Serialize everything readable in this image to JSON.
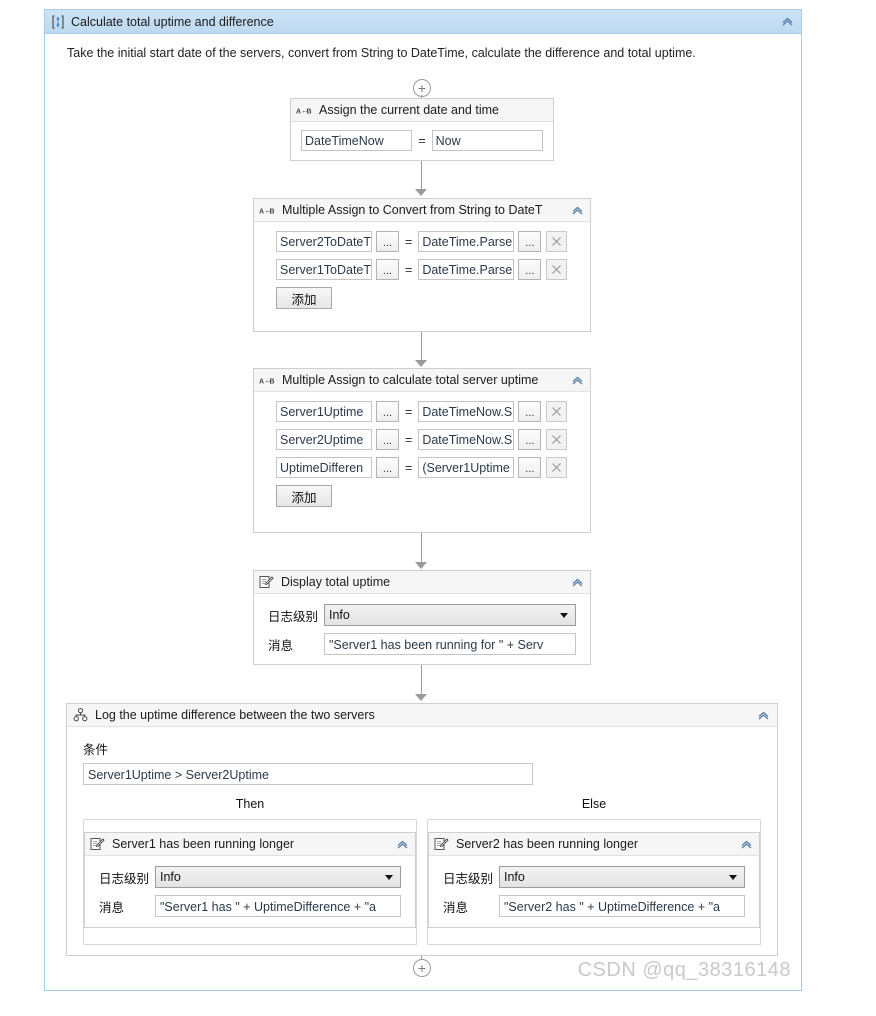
{
  "sequence": {
    "icon": "sequence-icon",
    "title": "Calculate total uptime and difference",
    "description": "Take the initial start date of the servers, convert from String to DateTime, calculate the difference and total uptime.",
    "collapse_icon": "chevron-up-icon",
    "top_plus": "+",
    "bottom_plus": "+"
  },
  "activities": {
    "assign_now": {
      "icon": "assign-icon",
      "title": "Assign the current date and time",
      "to_value": "DateTimeNow",
      "equals": "=",
      "value": "Now"
    },
    "multi_assign_convert": {
      "icon": "multiple-assign-icon",
      "title": "Multiple Assign to Convert from String to DateT",
      "collapse_icon": "chevron-up-icon",
      "add_label": "添加",
      "rows": [
        {
          "to": "Server2ToDateT",
          "equals": "=",
          "value": "DateTime.Parse",
          "browse": "...",
          "delete": "×"
        },
        {
          "to": "Server1ToDateT",
          "equals": "=",
          "value": "DateTime.Parse",
          "browse": "...",
          "delete": "×"
        }
      ]
    },
    "multi_assign_uptime": {
      "icon": "multiple-assign-icon",
      "title": "Multiple Assign to calculate total server uptime",
      "collapse_icon": "chevron-up-icon",
      "add_label": "添加",
      "rows": [
        {
          "to": "Server1Uptime",
          "equals": "=",
          "value": "DateTimeNow.S",
          "browse": "...",
          "delete": "×"
        },
        {
          "to": "Server2Uptime",
          "equals": "=",
          "value": "DateTimeNow.S",
          "browse": "...",
          "delete": "×"
        },
        {
          "to": "UptimeDifferen",
          "equals": "=",
          "value": "(Server1Uptime",
          "browse": "...",
          "delete": "×"
        }
      ]
    },
    "log_total_uptime": {
      "icon": "log-message-icon",
      "title": "Display total uptime",
      "collapse_icon": "chevron-up-icon",
      "level_label": "日志级别",
      "level_value": "Info",
      "message_label": "消息",
      "message_value": "\"Server1 has been running for \" + Serv"
    },
    "if_activity": {
      "icon": "if-icon",
      "title": "Log the uptime difference between the two servers",
      "collapse_icon": "chevron-up-icon",
      "condition_label": "条件",
      "condition_value": "Server1Uptime > Server2Uptime",
      "then_label": "Then",
      "else_label": "Else",
      "then_branch": {
        "icon": "log-message-icon",
        "title": "Server1 has been running longer",
        "collapse_icon": "chevron-up-icon",
        "level_label": "日志级别",
        "level_value": "Info",
        "message_label": "消息",
        "message_value": "\"Server1 has \" + UptimeDifference + \"a"
      },
      "else_branch": {
        "icon": "log-message-icon",
        "title": "Server2 has been running longer",
        "collapse_icon": "chevron-up-icon",
        "level_label": "日志级别",
        "level_value": "Info",
        "message_label": "消息",
        "message_value": "\"Server2 has \" + UptimeDifference + \"a"
      }
    }
  },
  "watermark": "CSDN @qq_38316148",
  "colors": {
    "sequence_header": "#c3dcf2",
    "sequence_border": "#a8cbe6",
    "card_header": "#f6f6f6",
    "card_border": "#cfcfcf",
    "connector": "#9a9a9a",
    "expression_text": "#2b3a4a",
    "watermark": "#c9c9c9"
  }
}
